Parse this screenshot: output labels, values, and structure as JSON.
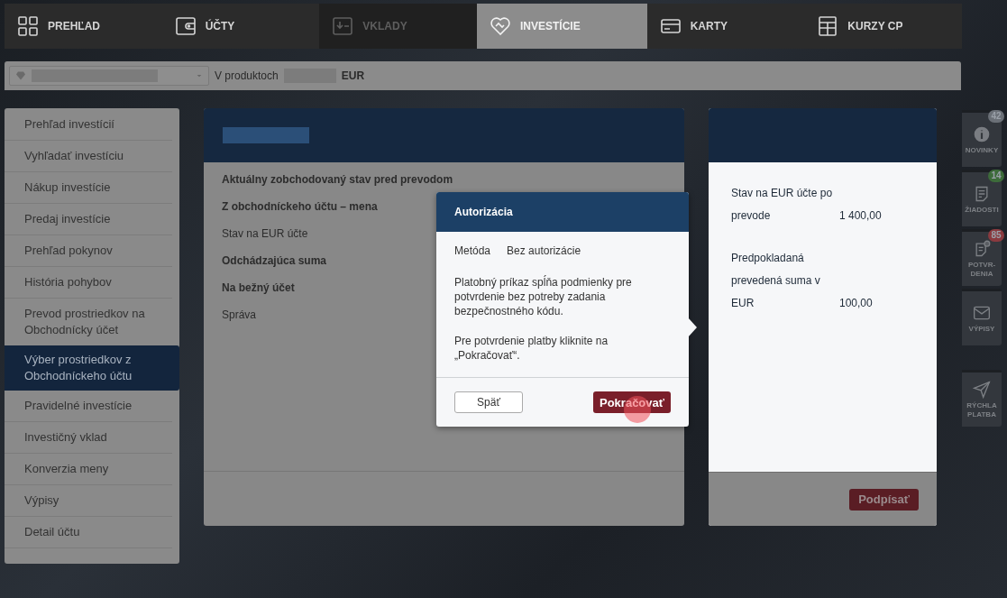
{
  "nav": {
    "tabs": [
      {
        "label": "PREHĽAD",
        "selected": false,
        "disabled": false
      },
      {
        "label": "ÚČTY",
        "selected": false,
        "disabled": false
      },
      {
        "label": "VKLADY",
        "selected": false,
        "disabled": true
      },
      {
        "label": "INVESTÍCIE",
        "selected": true,
        "disabled": false
      },
      {
        "label": "KARTY",
        "selected": false,
        "disabled": false
      },
      {
        "label": "KURZY CP",
        "selected": false,
        "disabled": false
      }
    ]
  },
  "account_bar": {
    "label": "V produktoch",
    "currency": "EUR"
  },
  "sidebar": {
    "items": [
      {
        "label": "Prehľad investícií",
        "selected": false
      },
      {
        "label": "Vyhľadať investíciu",
        "selected": false
      },
      {
        "label": "Nákup investície",
        "selected": false
      },
      {
        "label": "Predaj investície",
        "selected": false
      },
      {
        "label": "Prehľad pokynov",
        "selected": false
      },
      {
        "label": "História pohybov",
        "selected": false
      },
      {
        "label": "Prevod prostriedkov na Obchodnícky účet",
        "selected": false
      },
      {
        "label": "Výber prostriedkov z Obchodníckeho účtu",
        "selected": true
      },
      {
        "label": "Pravidelné investície",
        "selected": false
      },
      {
        "label": "Investičný vklad",
        "selected": false
      },
      {
        "label": "Konverzia meny",
        "selected": false
      },
      {
        "label": "Výpisy",
        "selected": false
      },
      {
        "label": "Detail účtu",
        "selected": false
      }
    ]
  },
  "form": {
    "rows": [
      {
        "label": "Aktuálny zobchodovaný stav pred prevodom",
        "kind": "heading"
      },
      {
        "label": "Z obchodníckeho účtu – mena",
        "kind": "heading"
      },
      {
        "label": "Stav na EUR účte",
        "kind": "field"
      },
      {
        "label": "Odchádzajúca suma",
        "kind": "heading"
      },
      {
        "label": "Na bežný účet",
        "kind": "heading"
      },
      {
        "label": "Správa",
        "kind": "field"
      }
    ]
  },
  "summary": {
    "rows": [
      {
        "label": "Stav na EUR účte po prevode",
        "value": "1 400,00"
      },
      {
        "label": "Predpokladaná prevedená suma v EUR",
        "value": "100,00"
      }
    ],
    "sign_button": "Podpísať"
  },
  "rail": {
    "items": [
      {
        "label": "NOVINKY",
        "badge": "42",
        "color": "#6b7077"
      },
      {
        "label": "ŽIADOSTI",
        "badge": "14",
        "color": "#3d6b3a"
      },
      {
        "label": "POTVR-DENIA",
        "badge": "85",
        "color": "#8a3a3f"
      },
      {
        "label": "VÝPISY"
      },
      {
        "label": "RÝCHLA PLATBA"
      }
    ]
  },
  "modal": {
    "title": "Autorizácia",
    "method_label": "Metóda",
    "method_value": "Bez autorizácie",
    "message": "Platobný príkaz spĺňa podmienky pre potvrdenie bez potreby zadania bezpečnostného kódu.",
    "instruction": "Pre potvrdenie platby kliknite na „Pokračovať“.",
    "back_button": "Späť",
    "continue_button": "Pokračovať"
  }
}
